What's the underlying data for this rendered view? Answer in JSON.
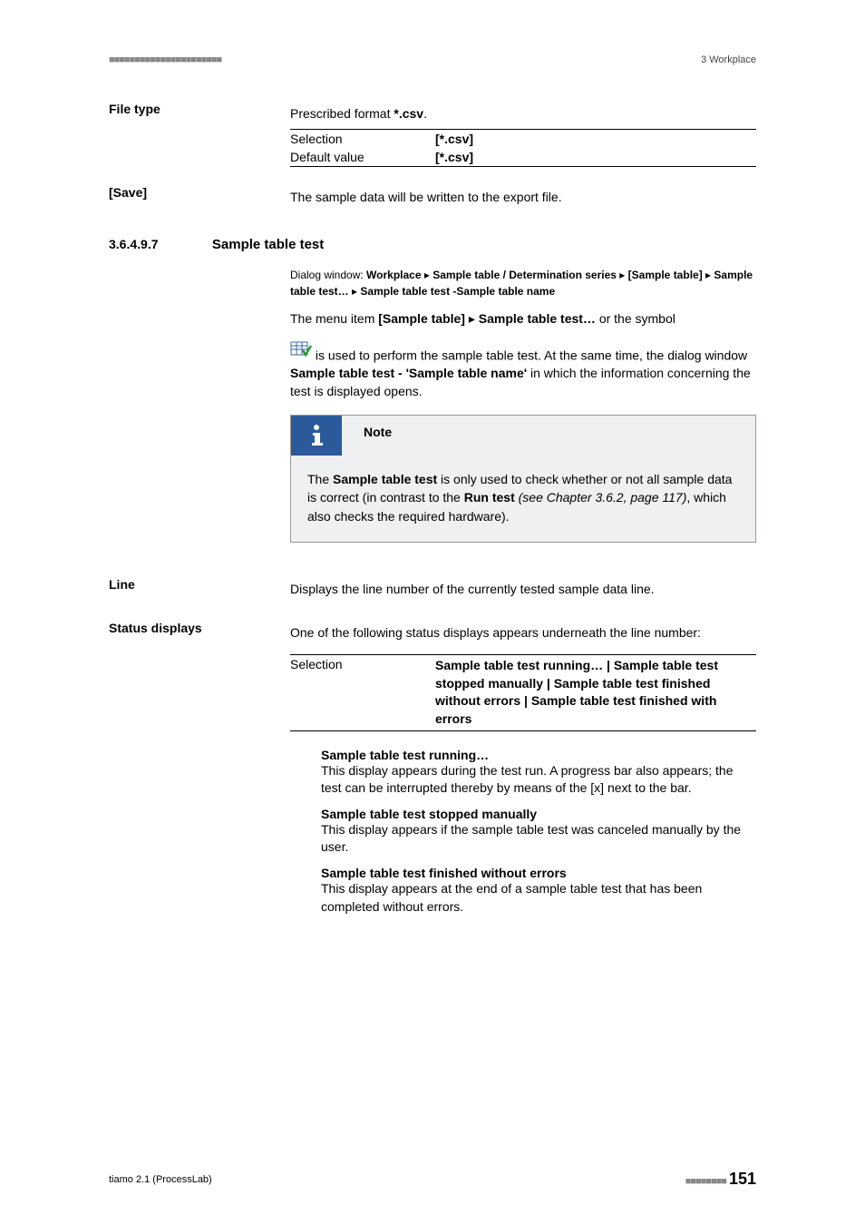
{
  "header": {
    "rule": "■■■■■■■■■■■■■■■■■■■■■■",
    "right": "3 Workplace"
  },
  "filetype": {
    "label": "File type",
    "prescribed_pre": "Prescribed format ",
    "prescribed_bold": "*.csv",
    "prescribed_post": ".",
    "rows": [
      {
        "k": "Selection",
        "v": "[*.csv]"
      },
      {
        "k": "Default value",
        "v": "[*.csv]"
      }
    ]
  },
  "save": {
    "label": "[Save]",
    "text": "The sample data will be written to the export file."
  },
  "section": {
    "num": "3.6.4.9.7",
    "title": "Sample table test",
    "dialog_parts": {
      "pre": "Dialog window: ",
      "p1": "Workplace",
      "p2": "Sample table / Determination series",
      "p3": "[Sample table]",
      "p4": "Sample table test…",
      "p5": "Sample table test -Sample table name"
    },
    "menu_line": {
      "a": "The menu item ",
      "b": "[Sample table]",
      "c": " ▸ ",
      "d": "Sample table test…",
      "e": " or the symbol"
    },
    "after_icon": {
      "a": " is used to perform the sample table test. At the same time, the dialog window ",
      "b": "Sample table test - 'Sample table name'",
      "c": " in which the information concerning the test is displayed opens."
    }
  },
  "note": {
    "label": "Note",
    "body": {
      "a": "The ",
      "b": "Sample table test",
      "c": " is only used to check whether or not all sample data is correct (in contrast to the ",
      "d": "Run test",
      "e": " (see Chapter 3.6.2, page 117)",
      "f": ", which also checks the required hardware)."
    }
  },
  "line": {
    "label": "Line",
    "text": "Displays the line number of the currently tested sample data line."
  },
  "status": {
    "label": "Status displays",
    "intro": "One of the following status displays appears underneath the line number:",
    "sel_key": "Selection",
    "sel_val": "Sample table test running… | Sample table test stopped manually | Sample table test finished without errors | Sample table test finished with errors",
    "items": [
      {
        "t": "Sample table test running…",
        "d": "This display appears during the test run. A progress bar also appears; the test can be interrupted thereby by means of the [x] next to the bar."
      },
      {
        "t": "Sample table test stopped manually",
        "d": "This display appears if the sample table test was canceled manually by the user."
      },
      {
        "t": "Sample table test finished without errors",
        "d": "This display appears at the end of a sample table test that has been completed without errors."
      }
    ]
  },
  "footer": {
    "left": "tiamo 2.1 (ProcessLab)",
    "rule": "■■■■■■■■",
    "page": "151"
  }
}
